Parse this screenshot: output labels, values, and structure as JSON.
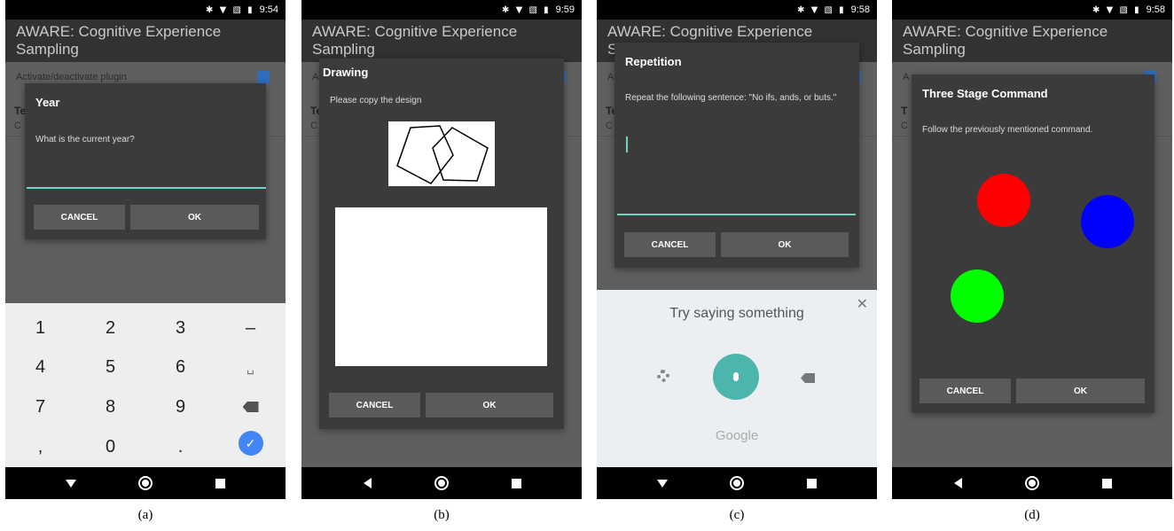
{
  "status": {
    "icons": "✱ ▼ ▧ ▮"
  },
  "panels": {
    "a": {
      "time": "9:54",
      "appbar": "AWARE: Cognitive Experience Sampling",
      "setting1": "Activate/deactivate plugin",
      "setting2_title": "Te",
      "setting2_sub": "C",
      "dialog": {
        "title": "Year",
        "body": "What is the current year?",
        "cancel": "CANCEL",
        "ok": "OK"
      },
      "keys": [
        "1",
        "2",
        "3",
        "–",
        "4",
        "5",
        "6",
        "␣",
        "7",
        "8",
        "9",
        "",
        ",",
        "0",
        "."
      ],
      "caption": "(a)"
    },
    "b": {
      "time": "9:59",
      "appbar": "AWARE: Cognitive Experience Sampling",
      "setting1": "Ac",
      "setting2_title": "Te",
      "setting2_sub": "C",
      "dialog": {
        "title": "Drawing",
        "body": "Please copy the design",
        "cancel": "CANCEL",
        "ok": "OK"
      },
      "caption": "(b)"
    },
    "c": {
      "time": "9:58",
      "appbar": "AWARE: Cognitive Experience Sampling",
      "setting1": "Ac",
      "setting2_title": "Te",
      "setting2_sub": "C",
      "dialog": {
        "title": "Repetition",
        "body": "Repeat the following sentence: \"No ifs, ands, or buts.\"",
        "cancel": "CANCEL",
        "ok": "OK"
      },
      "voice": {
        "prompt": "Try saying something",
        "brand": "Google",
        "close": "✕"
      },
      "caption": "(c)"
    },
    "d": {
      "time": "9:58",
      "appbar": "AWARE: Cognitive Experience Sampling",
      "setting1": "A",
      "setting2_title": "T",
      "setting2_sub": "C",
      "dialog": {
        "title": "Three Stage Command",
        "body": "Follow the previously mentioned command.",
        "cancel": "CANCEL",
        "ok": "OK"
      },
      "circle_colors": {
        "red": "#ff0000",
        "blue": "#0000ff",
        "green": "#00ff00"
      },
      "caption": "(d)"
    }
  }
}
